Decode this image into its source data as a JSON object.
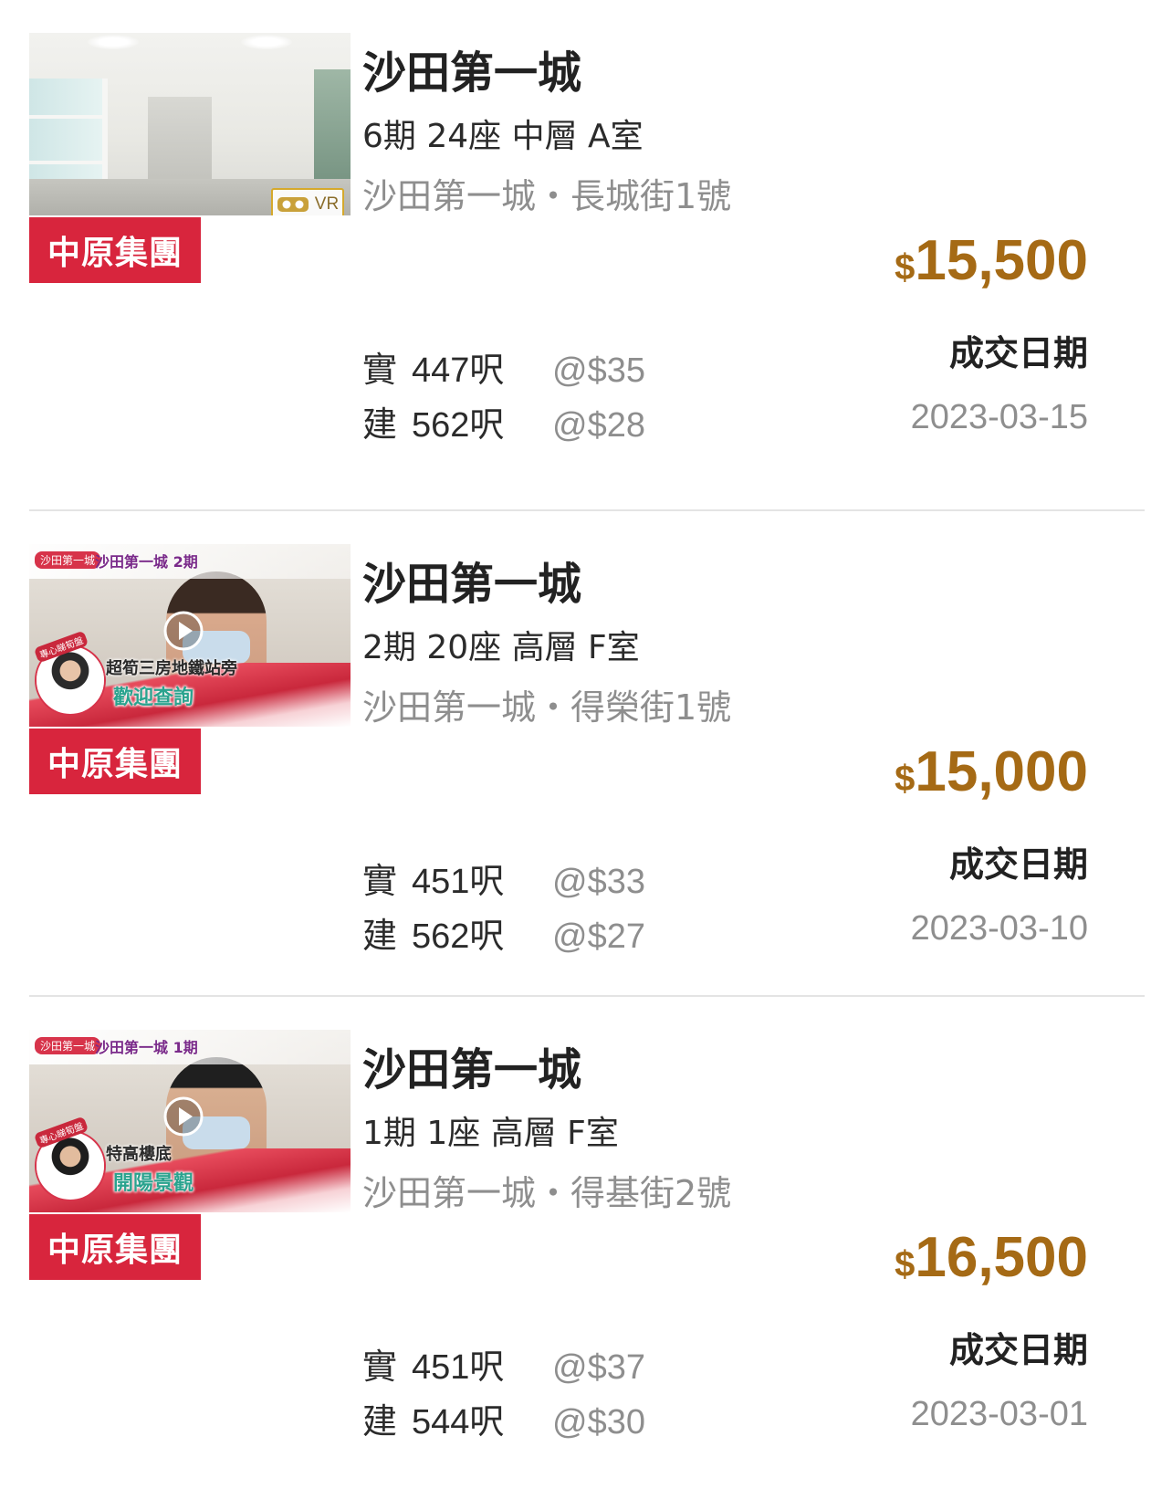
{
  "listings": [
    {
      "thumbnail": {
        "type": "photo",
        "badge": "VR"
      },
      "agency": "中原集團",
      "estate": "沙田第一城",
      "unit": "6期 24座 中層 A室",
      "address": "沙田第一城・長城街1號",
      "price_currency": "$",
      "price_amount": "15,500",
      "deal_label": "成交日期",
      "deal_date": "2023-03-15",
      "saleable": {
        "label": "實",
        "size": "447呎",
        "ppf": "@$35"
      },
      "gross": {
        "label": "建",
        "size": "562呎",
        "ppf": "@$28"
      }
    },
    {
      "thumbnail": {
        "type": "video",
        "tag": "沙田第一城",
        "title": "沙田第一城 2期",
        "avatar_tag": "專心睇筍盤",
        "caption1": "超筍三房地鐵站旁",
        "caption2": "歡迎查詢"
      },
      "agency": "中原集團",
      "estate": "沙田第一城",
      "unit": "2期 20座 高層 F室",
      "address": "沙田第一城・得榮街1號",
      "price_currency": "$",
      "price_amount": "15,000",
      "deal_label": "成交日期",
      "deal_date": "2023-03-10",
      "saleable": {
        "label": "實",
        "size": "451呎",
        "ppf": "@$33"
      },
      "gross": {
        "label": "建",
        "size": "562呎",
        "ppf": "@$27"
      }
    },
    {
      "thumbnail": {
        "type": "video",
        "tag": "沙田第一城",
        "title": "沙田第一城 1期",
        "avatar_tag": "專心睇筍盤",
        "caption1": "特高樓底",
        "caption2": "開陽景觀"
      },
      "agency": "中原集團",
      "estate": "沙田第一城",
      "unit": "1期 1座 高層 F室",
      "address": "沙田第一城・得基街2號",
      "price_currency": "$",
      "price_amount": "16,500",
      "deal_label": "成交日期",
      "deal_date": "2023-03-01",
      "saleable": {
        "label": "實",
        "size": "451呎",
        "ppf": "@$37"
      },
      "gross": {
        "label": "建",
        "size": "544呎",
        "ppf": "@$30"
      }
    }
  ],
  "colors": {
    "agency_bg": "#d8253d",
    "price": "#a56a15",
    "muted_text": "#8e8e8e",
    "divider": "#e4e4e4"
  }
}
